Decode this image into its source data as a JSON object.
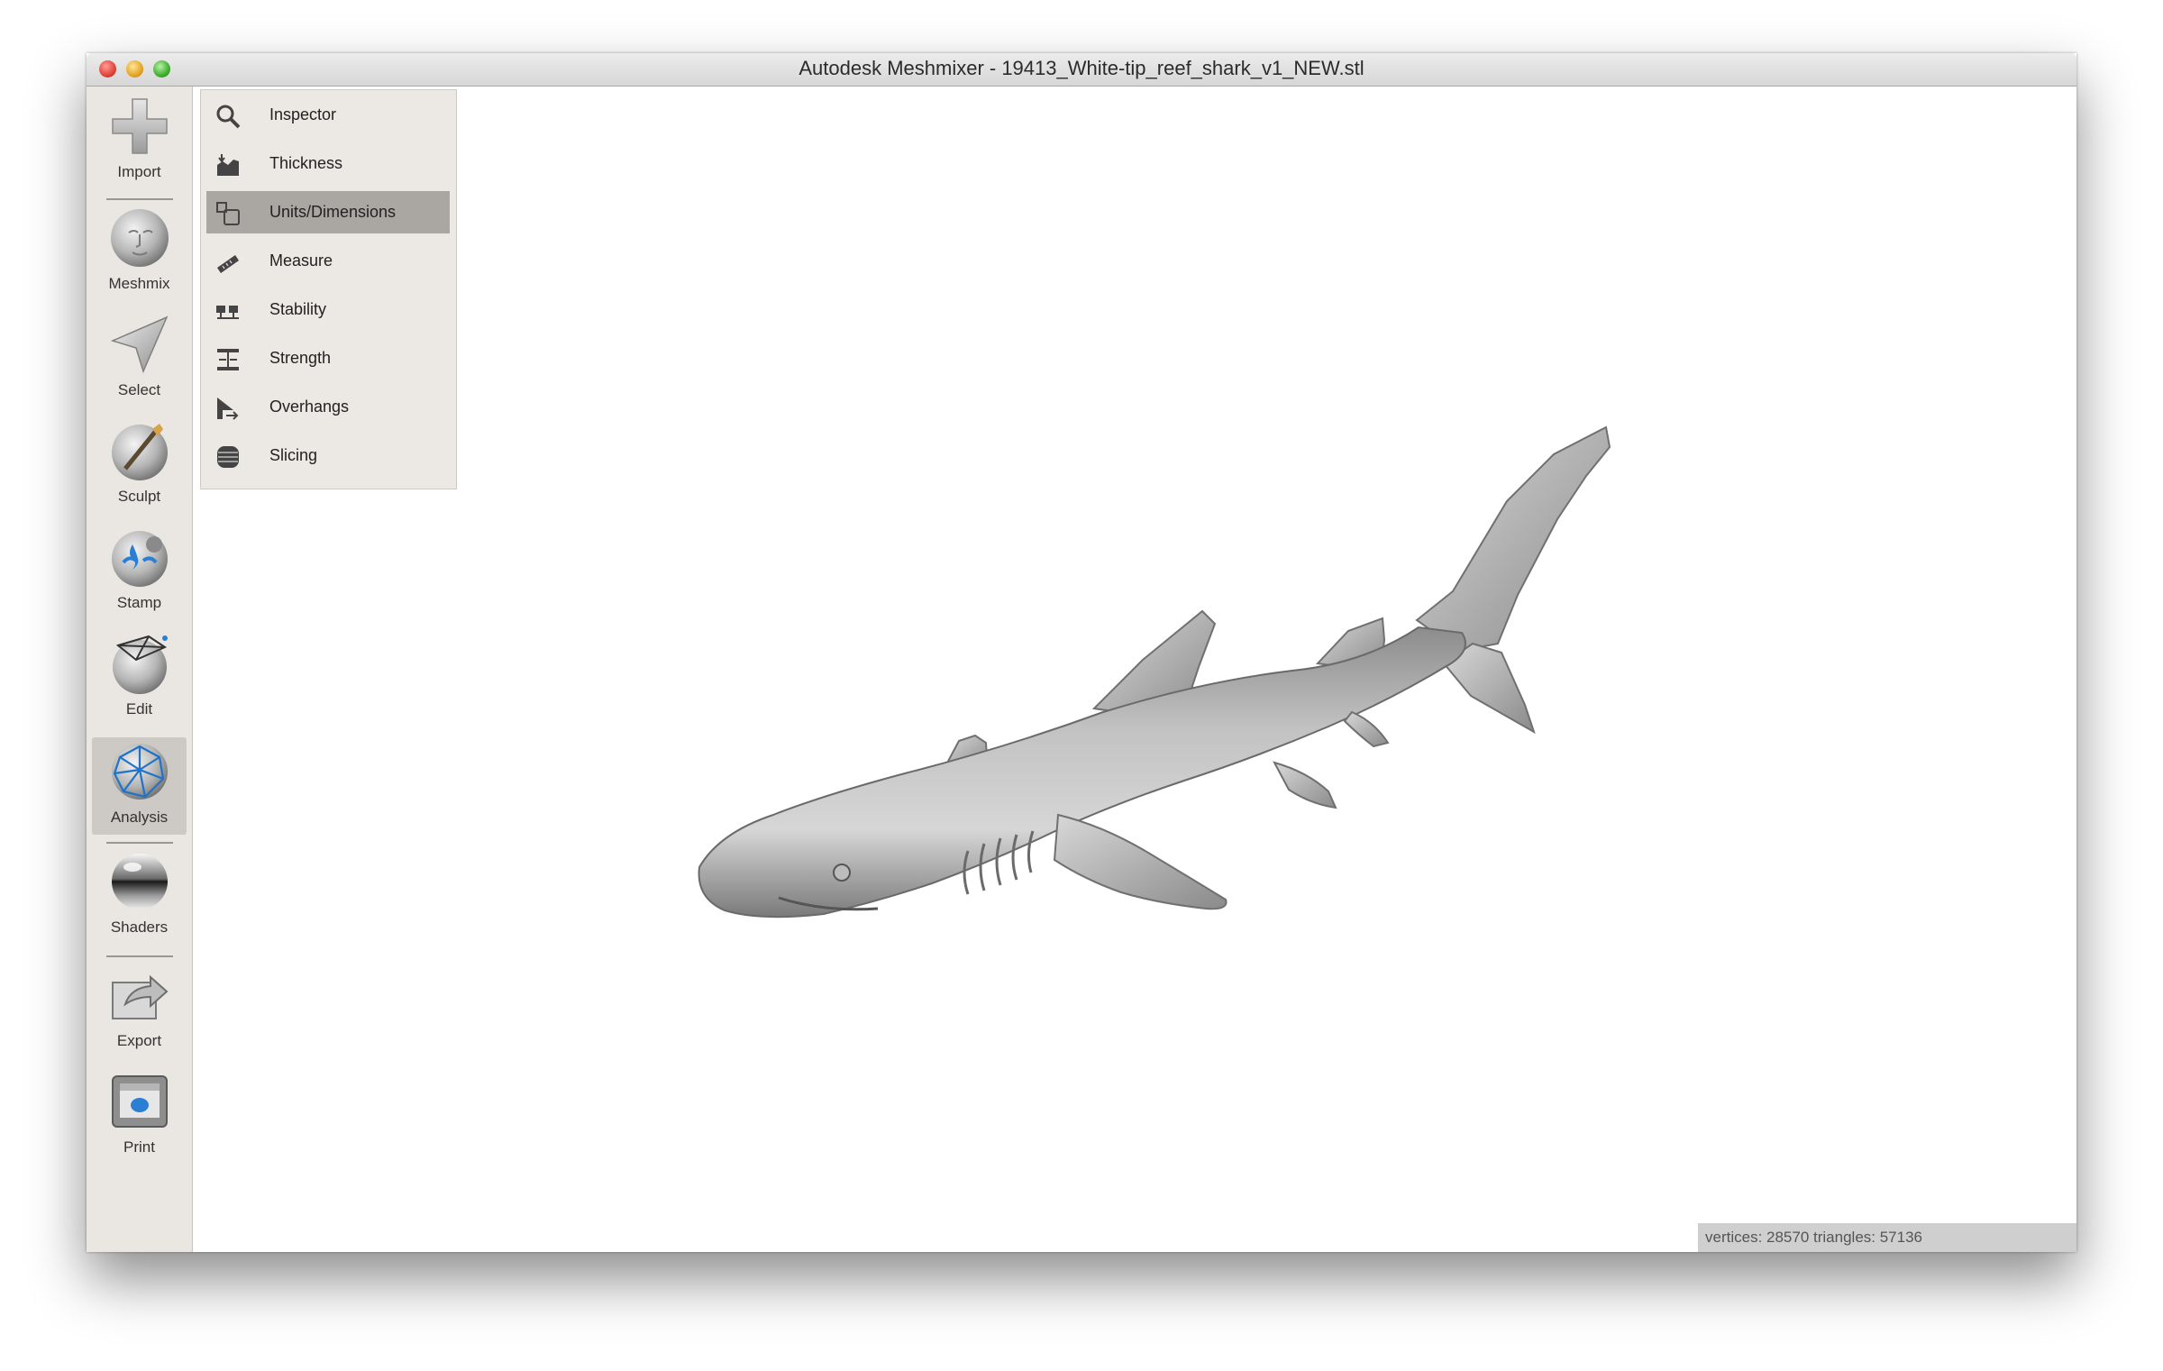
{
  "window": {
    "title": "Autodesk Meshmixer - 19413_White-tip_reef_shark_v1_NEW.stl"
  },
  "toolbar": {
    "items": [
      {
        "label": "Import",
        "icon": "plus-icon"
      },
      {
        "label": "Meshmix",
        "icon": "face-sphere-icon"
      },
      {
        "label": "Select",
        "icon": "arrow-cursor-icon"
      },
      {
        "label": "Sculpt",
        "icon": "brush-sphere-icon"
      },
      {
        "label": "Stamp",
        "icon": "stamp-sphere-icon"
      },
      {
        "label": "Edit",
        "icon": "edit-sphere-icon"
      },
      {
        "label": "Analysis",
        "icon": "mesh-sphere-icon",
        "active": true
      },
      {
        "label": "Shaders",
        "icon": "chrome-sphere-icon"
      },
      {
        "label": "Export",
        "icon": "export-icon"
      },
      {
        "label": "Print",
        "icon": "printer-icon"
      }
    ]
  },
  "analysis_panel": {
    "items": [
      {
        "label": "Inspector",
        "icon": "magnifier-icon"
      },
      {
        "label": "Thickness",
        "icon": "thickness-icon"
      },
      {
        "label": "Units/Dimensions",
        "icon": "units-icon",
        "selected": true
      },
      {
        "label": "Measure",
        "icon": "ruler-icon"
      },
      {
        "label": "Stability",
        "icon": "stability-icon"
      },
      {
        "label": "Strength",
        "icon": "strength-icon"
      },
      {
        "label": "Overhangs",
        "icon": "overhangs-icon"
      },
      {
        "label": "Slicing",
        "icon": "slicing-icon"
      }
    ]
  },
  "status_bar": {
    "text": "vertices: 28570 triangles: 57136"
  },
  "colors": {
    "toolbar_bg": "#eae6e1",
    "panel_bg": "#ece8e3",
    "selected_bg": "#aaa7a3",
    "model_gray": "#a8a8a8"
  }
}
